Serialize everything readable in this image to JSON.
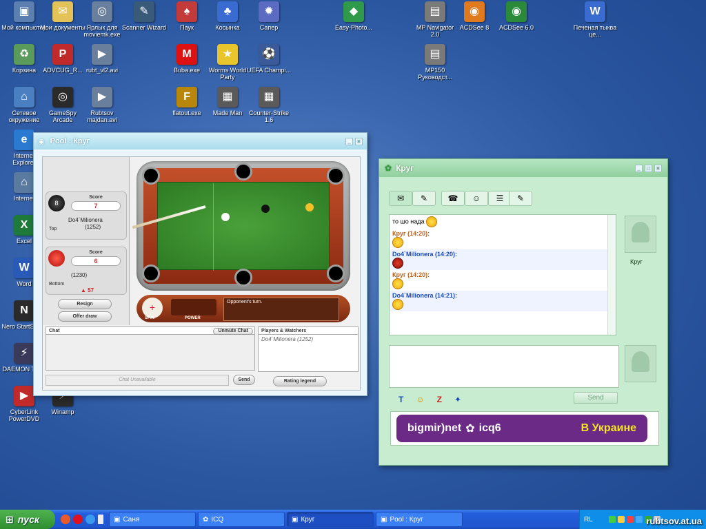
{
  "desktop": {
    "icons": [
      {
        "label": "Мой компьютер",
        "color": "#5b7fb0",
        "glyph": "▣"
      },
      {
        "label": "Мои документы",
        "color": "#e4c25a",
        "glyph": "✉"
      },
      {
        "label": "Ярлык для moviemk.exe",
        "color": "#6a7f9b",
        "glyph": "◎"
      },
      {
        "label": "Scanner Wizard",
        "color": "#3a5a7a",
        "glyph": "✎"
      },
      {
        "label": "Паук",
        "color": "#c23a3a",
        "glyph": "♠"
      },
      {
        "label": "Косынка",
        "color": "#3a6bd1",
        "glyph": "♣"
      },
      {
        "label": "Сапер",
        "color": "#5a6bc1",
        "glyph": "✹"
      },
      {
        "label": "Easy-Photo...",
        "color": "#2f9a4a",
        "glyph": "◆"
      },
      {
        "label": "MP Navigator 2.0",
        "color": "#7a7a7a",
        "glyph": "▤"
      },
      {
        "label": "ACDSee 8",
        "color": "#e07a1e",
        "glyph": "◉"
      },
      {
        "label": "ACDSee 6.0",
        "color": "#2b8a3a",
        "glyph": "◉"
      },
      {
        "label": "Печеная тыква це...",
        "color": "#3a6bd1",
        "glyph": "W"
      },
      {
        "label": "Корзина",
        "color": "#5a9a5a",
        "glyph": "♻"
      },
      {
        "label": "ADVCUG_R...",
        "color": "#c12a2a",
        "glyph": "P"
      },
      {
        "label": "rubt_vl2.avi",
        "color": "#6a7f9b",
        "glyph": "▶"
      },
      {
        "label": "Buba.exe",
        "color": "#d11",
        "glyph": "M"
      },
      {
        "label": "Worms World Party",
        "color": "#e8c52a",
        "glyph": "★"
      },
      {
        "label": "UEFA Champi...",
        "color": "#3a5a9a",
        "glyph": "⚽"
      },
      {
        "label": "MP150 Руководст...",
        "color": "#7a7a7a",
        "glyph": "▤"
      },
      {
        "label": "Сетевое окружение",
        "color": "#4a7fc1",
        "glyph": "⌂"
      },
      {
        "label": "GameSpy Arcade",
        "color": "#2a2a2a",
        "glyph": "◎"
      },
      {
        "label": "Rubtsov majdan.avi",
        "color": "#6a7f9b",
        "glyph": "▶"
      },
      {
        "label": "flatout.exe",
        "color": "#b8860b",
        "glyph": "F"
      },
      {
        "label": "Made Man",
        "color": "#5a5a5a",
        "glyph": "▦"
      },
      {
        "label": "Counter-Strike 1.6",
        "color": "#5a5a5a",
        "glyph": "▦"
      },
      {
        "label": "Internet Explorer",
        "color": "#2a7ad1",
        "glyph": "e"
      },
      {
        "label": "Internet",
        "color": "#5a7aa0",
        "glyph": "⌂"
      },
      {
        "label": "Excel",
        "color": "#1e7a3a",
        "glyph": "X"
      },
      {
        "label": "Word",
        "color": "#2a5ab8",
        "glyph": "W"
      },
      {
        "label": "Nero StartSmart",
        "color": "#2a2a2a",
        "glyph": "N"
      },
      {
        "label": "DAEMON Tools",
        "color": "#3a3a5a",
        "glyph": "⚡"
      },
      {
        "label": "CyberLink PowerDVD",
        "color": "#c12a2a",
        "glyph": "▶"
      },
      {
        "label": "Winamp",
        "color": "#2a2a2a",
        "glyph": "⚡"
      }
    ]
  },
  "pool": {
    "title": "Pool : Круг",
    "top_player": {
      "score_label": "Score",
      "score": "7",
      "name": "Do4`Milionera",
      "rating": "(1252)",
      "position": "Top"
    },
    "bottom_player": {
      "score_label": "Score",
      "score": "6",
      "rating": "(1230)",
      "position": "Bottom",
      "delta": "▲ 57"
    },
    "resign": "Resign",
    "offer_draw": "Offer draw",
    "spin": "SPIN",
    "power": "POWER",
    "status_message": "Opponent's turn.",
    "chat_header": "Chat",
    "unmute": "Unmute Chat",
    "chat_placeholder": "Chat Unavailable",
    "send": "Send",
    "watchers_header": "Players & Watchers",
    "watcher": "Do4`Milionera (1252)",
    "rating_legend": "Rating legend"
  },
  "icq": {
    "title": "Круг",
    "messages": [
      {
        "who": "",
        "text": "то шо нада",
        "smile": "yellow"
      },
      {
        "who": "Круг (14:20):",
        "text": "",
        "smile": "yellow",
        "color": "#c0601a"
      },
      {
        "who": "Do4`Milionera (14:20):",
        "text": "",
        "smile": "red",
        "color": "#1a4ab8"
      },
      {
        "who": "Круг (14:20):",
        "text": "",
        "smile": "yellow",
        "color": "#c0601a"
      },
      {
        "who": "Do4`Milionera (14:21):",
        "text": "",
        "smile": "yellow",
        "color": "#1a4ab8"
      }
    ],
    "contact": "Круг",
    "send": "Send",
    "banner": {
      "left": "bigmir)net",
      "mid": "icq6",
      "right": "В Украине"
    }
  },
  "taskbar": {
    "start": "пуск",
    "tasks": [
      "Саня",
      "ICQ",
      "Круг",
      "Pool : Круг"
    ],
    "lang": "RL",
    "watermark": "rubtsov.at.ua"
  },
  "colors": {
    "pool_felt": "#3a8f2e",
    "icq_accent": "#91d09f",
    "taskbar": "#245edb",
    "start_green": "#3f9f3f"
  }
}
